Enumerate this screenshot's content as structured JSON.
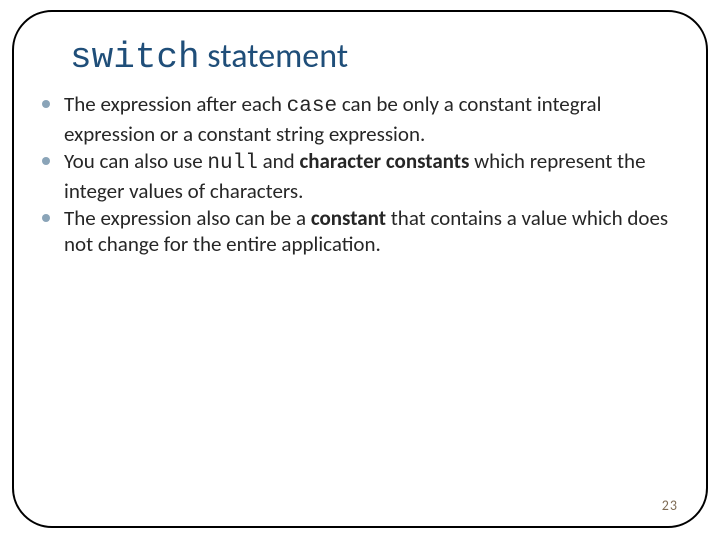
{
  "title": {
    "code": "switch",
    "rest": " statement"
  },
  "bullets": [
    {
      "parts": [
        {
          "text": "The expression after each ",
          "style": "plain"
        },
        {
          "text": "case",
          "style": "mono"
        },
        {
          "text": " can be only a constant integral expression or a constant string expression.",
          "style": "plain"
        }
      ]
    },
    {
      "parts": [
        {
          "text": "You can also use ",
          "style": "plain"
        },
        {
          "text": "null",
          "style": "mono"
        },
        {
          "text": " and ",
          "style": "plain"
        },
        {
          "text": "character constants",
          "style": "bold"
        },
        {
          "text": " which represent the integer values of characters.",
          "style": "plain"
        }
      ]
    },
    {
      "parts": [
        {
          "text": "The expression also can be a ",
          "style": "plain"
        },
        {
          "text": "constant",
          "style": "bold"
        },
        {
          "text": " that contains a value which does not change for the entire application.",
          "style": "plain"
        }
      ]
    }
  ],
  "page_number": "23"
}
